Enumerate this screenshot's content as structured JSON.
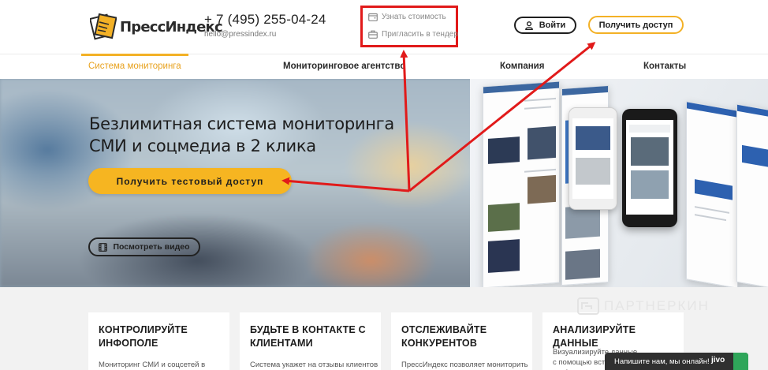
{
  "header": {
    "logo_text": "ПрессИндекс",
    "phone": "+ 7 (495) 255-04-24",
    "email": "hello@pressindex.ru",
    "links": {
      "price": "Узнать стоимость",
      "tender": "Пригласить в тендер"
    },
    "login_label": "Войти",
    "access_label": "Получить доступ"
  },
  "nav": {
    "items": [
      {
        "label": "Система мониторинга",
        "active": true
      },
      {
        "label": "Мониторинговое агентство",
        "active": false
      },
      {
        "label": "Компания",
        "active": false
      },
      {
        "label": "Контакты",
        "active": false
      }
    ]
  },
  "hero": {
    "title_line1": "Безлимитная система мониторинга",
    "title_line2": "СМИ и соцмедиа в 2 клика",
    "test_button": "Получить тестовый доступ",
    "video_button": "Посмотреть видео"
  },
  "features": [
    {
      "title_line1": "КОНТРОЛИРУЙТЕ",
      "title_line2": "ИНФОПОЛЕ",
      "text": "Мониторинг СМИ и соцсетей в"
    },
    {
      "title_line1": "БУДЬТЕ В КОНТАКТЕ С",
      "title_line2": "КЛИЕНТАМИ",
      "text": "Система укажет на отзывы клиентов"
    },
    {
      "title_line1": "ОТСЛЕЖИВАЙТЕ",
      "title_line2": "КОНКУРЕНТОВ",
      "text": "ПрессИндекс позволяет мониторить"
    },
    {
      "title_line1": "АНАЛИЗИРУЙТЕ ДАННЫЕ",
      "title_line2": "",
      "text": "Визуализируйте данные с помощью встроенных графиков"
    }
  ],
  "watermark": "ПАРТНЕРКИН",
  "chat": {
    "label": "Напишите нам, мы онлайн!",
    "brand": "jivo"
  },
  "colors": {
    "accent": "#f3b126",
    "highlight": "#e11a1a",
    "chat_bg": "#303030"
  },
  "icons": {
    "price": "wallet-icon",
    "tender": "briefcase-icon",
    "login": "user-icon",
    "video": "film-icon"
  }
}
